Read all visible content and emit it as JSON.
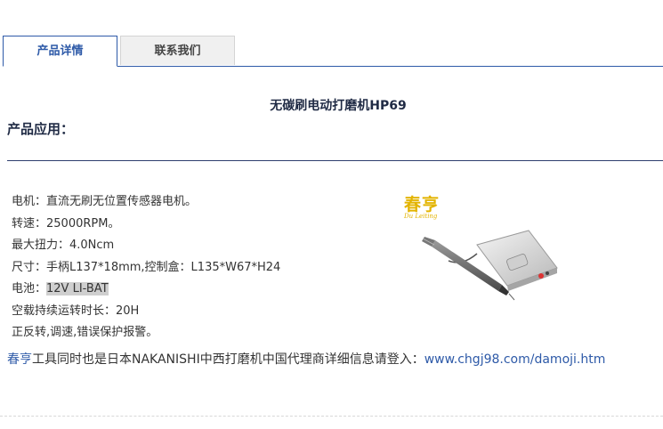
{
  "tabs": [
    {
      "label": "产品详情"
    },
    {
      "label": "联系我们"
    }
  ],
  "product": {
    "title": "无碳刷电动打磨机HP69",
    "section_heading": "产品应用："
  },
  "specs": {
    "motor": "电机：直流无刷无位置传感器电机。",
    "speed": "转速：25000RPM。",
    "torque": "最大扭力：4.0Ncm",
    "size": "尺寸：手柄L137*18mm,控制盒：L135*W67*H24",
    "battery_label": "电池：",
    "battery_value": "12V LI-BAT",
    "runtime": "空载持续运转时长：20H",
    "features": "正反转,调速,错误保护报警。"
  },
  "logo": {
    "cn": "春亨",
    "en": "Du Leiting"
  },
  "note": {
    "brand": "春亨",
    "text": "工具同时也是日本NAKANISHI中西打磨机中国代理商详细信息请登入：",
    "link": "www.chgj98.com/damoji.htm"
  },
  "colors": {
    "accent": "#2e5aa8",
    "logo": "#e3b400"
  }
}
